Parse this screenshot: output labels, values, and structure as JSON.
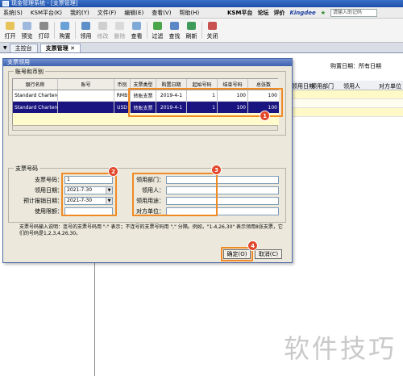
{
  "app": {
    "title": "现金管理系统 - [支票管理]",
    "menu": [
      "系统(S)",
      "KSM平台(K)",
      "我的(Y)",
      "文件(F)",
      "编辑(E)",
      "查看(V)",
      "帮助(H)"
    ],
    "platform_links": [
      "KSM平台",
      "论坛",
      "评价"
    ],
    "brand": "Kingdee",
    "search_placeholder": "请输入助记码"
  },
  "toolbar": {
    "buttons": [
      {
        "label": "打开",
        "enabled": true
      },
      {
        "label": "预览",
        "enabled": true
      },
      {
        "label": "打印",
        "enabled": true
      },
      {
        "label": "购置",
        "enabled": true
      },
      {
        "label": "领用",
        "enabled": true
      },
      {
        "label": "修改",
        "enabled": false
      },
      {
        "label": "删除",
        "enabled": false
      },
      {
        "label": "查看",
        "enabled": true
      },
      {
        "label": "过滤",
        "enabled": true
      },
      {
        "label": "查找",
        "enabled": true
      },
      {
        "label": "刷新",
        "enabled": true
      },
      {
        "label": "关闭",
        "enabled": true
      }
    ]
  },
  "tabs": [
    "主控台",
    "支票管理"
  ],
  "background": {
    "purchase_date_label": "购置日期：所有日期",
    "grid_headers": [
      "领用日期",
      "领用部门",
      "领用人",
      "对方单位"
    ]
  },
  "dialog": {
    "title": "支票领用",
    "account_group": "账号和币别",
    "columns": [
      "银行名称",
      "账号",
      "币别",
      "支票类型",
      "购置日期",
      "起始号码",
      "结束号码",
      "总张数"
    ],
    "rows": [
      {
        "bank": "Standard Chartered B",
        "account": "",
        "currency": "RMB",
        "type": "转账支票",
        "date": "2019-4-1",
        "start": "1",
        "end": "100",
        "total": "100"
      },
      {
        "bank": "Standard Chartered B",
        "account": "",
        "currency": "USD",
        "type": "转账支票",
        "date": "2019-4-1",
        "start": "1",
        "end": "100",
        "total": "100"
      }
    ],
    "number_group": "支票号码",
    "fields_left": {
      "check_no": {
        "label": "支票号码：",
        "value": "1"
      },
      "use_date": {
        "label": "领用日期：",
        "value": "2021-7-30"
      },
      "report_date": {
        "label": "预计报销日期：",
        "value": "2021-7-30"
      },
      "limit": {
        "label": "使用限额：",
        "value": ""
      }
    },
    "fields_right": {
      "dept": {
        "label": "领用部门：",
        "value": ""
      },
      "person": {
        "label": "领用人：",
        "value": ""
      },
      "purpose": {
        "label": "领用用途：",
        "value": ""
      },
      "counterparty": {
        "label": "对方单位：",
        "value": ""
      }
    },
    "note": "支票号码输入说明：连号的支票号码用 \"-\" 表示；不连号的支票号码用 \",\" 分隔。例如，\"1-4,26,30\" 表示领用8张支票，它们的号码是1,2,3,4,26,30。",
    "ok_label": "确定(O)",
    "cancel_label": "取消(C)"
  },
  "callouts": [
    "1",
    "2",
    "3",
    "4"
  ],
  "watermark": "软件技巧",
  "colors": {
    "accent_callout": "#f08a24",
    "badge": "#e2472b",
    "selected_row": "#1a1480"
  }
}
